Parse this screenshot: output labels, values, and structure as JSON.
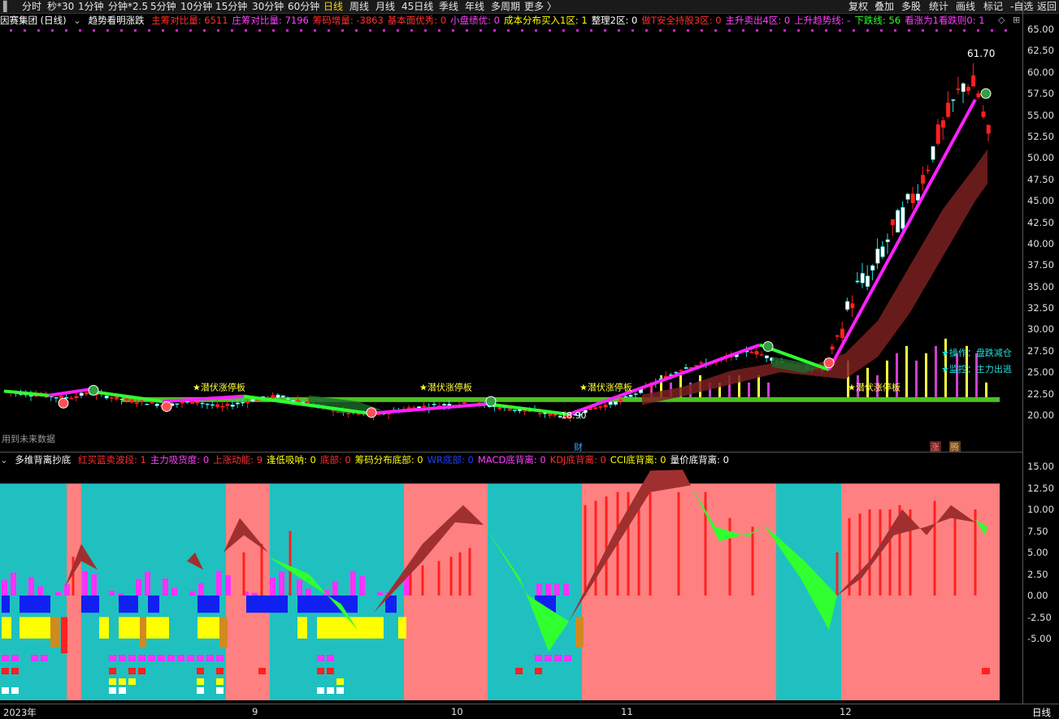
{
  "toolbar": {
    "left_items": [
      "分时",
      "秒*30",
      "1分钟",
      "分钟*2.5",
      "5分钟",
      "10分钟",
      "15分钟",
      "30分钟",
      "60分钟",
      "日线",
      "周线",
      "月线",
      "45日线",
      "季线",
      "年线",
      "多周期",
      "更多 〉"
    ],
    "active_item": "日线",
    "right_items": [
      "复权",
      "叠加",
      "多股",
      "统计",
      "画线",
      "标记",
      "-自选",
      "返回"
    ]
  },
  "header": {
    "stock_name": "因赛集团 (日线)",
    "indicator_name": "趋势看明涨跌",
    "stats": [
      {
        "text": "主筹对比量: 6511",
        "color": "#ff3030"
      },
      {
        "text": "庄筹对比量: 7196",
        "color": "#ff40ff"
      },
      {
        "text": "筹码增量: -3863",
        "color": "#ff3030"
      },
      {
        "text": "基本面优秀: 0",
        "color": "#ff3030"
      },
      {
        "text": "小盘绩优: 0",
        "color": "#ff40ff"
      },
      {
        "text": "成本分布买入1区: 1",
        "color": "#ffff00"
      },
      {
        "text": "整理2区: 0",
        "color": "#ffffff"
      },
      {
        "text": "做T安全持股3区: 0",
        "color": "#ff3030"
      },
      {
        "text": "主升卖出4区: 0",
        "color": "#ff40ff"
      },
      {
        "text": "上升趋势线: -",
        "color": "#ff40ff"
      },
      {
        "text": "下跌线: 56",
        "color": "#30ff30"
      },
      {
        "text": "看涨为1看跌则0: 1",
        "color": "#ff40ff"
      }
    ]
  },
  "main_chart": {
    "y_ticks": [
      "65.00",
      "62.50",
      "60.00",
      "57.50",
      "55.00",
      "52.50",
      "50.00",
      "47.50",
      "45.00",
      "42.50",
      "40.00",
      "37.50",
      "35.00",
      "32.50",
      "30.00",
      "27.50",
      "25.00",
      "22.50",
      "20.00"
    ],
    "y_values": [
      65,
      62.5,
      60,
      57.5,
      55,
      52.5,
      50,
      47.5,
      45,
      42.5,
      40,
      37.5,
      35,
      32.5,
      30,
      27.5,
      25,
      22.5,
      20
    ],
    "high_label": "61.70",
    "low_label": "18.90",
    "future_note": "用到未来数据",
    "right_notes": [
      "★操作：盘跌减仓",
      "★监控：主力出逃"
    ],
    "badge_cai": "财",
    "badge_zhang": "涨",
    "badge_teng": "腾",
    "tags": [
      "★潜伏涨停板",
      "★潜伏涨停板",
      "★潜伏涨停板",
      "★潜伏涨停板"
    ],
    "colors": {
      "up": "#ff2020",
      "down": "#00e0e0",
      "trend_up": "#ff20ff",
      "trend_down": "#30ff30",
      "band": "#7a2020"
    }
  },
  "indicator": {
    "name": "多维背离抄底",
    "stats": [
      {
        "text": "红买蓝卖波段: 1",
        "color": "#ff3030"
      },
      {
        "text": "主力吸货度: 0",
        "color": "#ff40ff"
      },
      {
        "text": "上涨动能: 9",
        "color": "#ff3030"
      },
      {
        "text": "逢低吸呐: 0",
        "color": "#ffff00"
      },
      {
        "text": "底部: 0",
        "color": "#ff3030"
      },
      {
        "text": "筹码分布底部: 0",
        "color": "#ffff00"
      },
      {
        "text": "WR底部: 0",
        "color": "#2040ff"
      },
      {
        "text": "MACD底背离: 0",
        "color": "#ff40ff"
      },
      {
        "text": "KDJ底背离: 0",
        "color": "#ff3030"
      },
      {
        "text": "CCI底背离: 0",
        "color": "#ffff00"
      },
      {
        "text": "量价底背离: 0",
        "color": "#ffffff"
      }
    ],
    "y_ticks": [
      "15.00",
      "12.50",
      "10.00",
      "7.50",
      "5.00",
      "2.50",
      "0.00",
      "-2.50",
      "-5.00"
    ],
    "y_values": [
      15,
      12.5,
      10,
      7.5,
      5,
      2.5,
      0,
      -2.5,
      -5
    ]
  },
  "x_axis": {
    "labels": [
      "2023年",
      "9",
      "10",
      "11",
      "12"
    ],
    "period": "日线"
  }
}
